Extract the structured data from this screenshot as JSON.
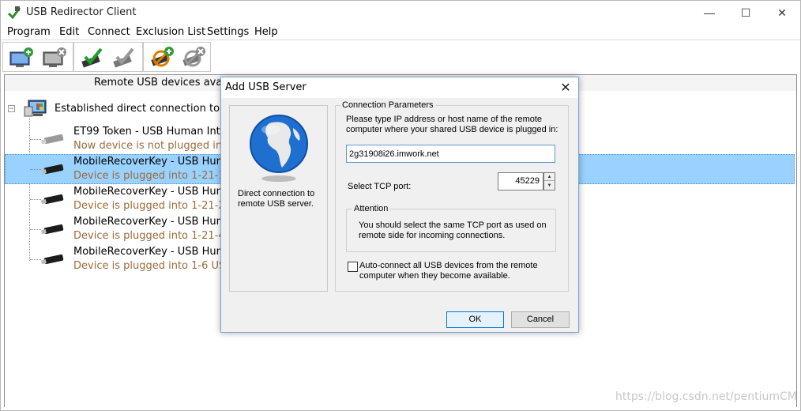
{
  "window": {
    "title": "USB Redirector Client",
    "minimize_glyph": "—",
    "maximize_glyph": "☐",
    "close_glyph": "✕"
  },
  "menu": [
    "Program",
    "Edit",
    "Connect",
    "Exclusion List",
    "Settings",
    "Help"
  ],
  "toolbar": {
    "buttons": [
      {
        "icon": "add-server-icon"
      },
      {
        "icon": "remove-server-icon"
      },
      {
        "icon": "connect-device-icon"
      },
      {
        "icon": "disconnect-device-icon"
      },
      {
        "icon": "add-exclusion-icon"
      },
      {
        "icon": "remove-exclusion-icon"
      }
    ]
  },
  "tab": {
    "label": "Remote USB devices avail"
  },
  "tree": {
    "expander": "−",
    "root_label": "Established direct connection to USB",
    "devices": [
      {
        "name": "ET99 Token - USB Human Interfa",
        "status": "Now device is not plugged into",
        "selected": false
      },
      {
        "name": "MobileRecoverKey - USB Human",
        "status": "Device is plugged into 1-21-1 US",
        "selected": true
      },
      {
        "name": "MobileRecoverKey - USB Human",
        "status": "Device is plugged into 1-21-2 US",
        "selected": false
      },
      {
        "name": "MobileRecoverKey - USB Human",
        "status": "Device is plugged into 1-21-4 US",
        "selected": false
      },
      {
        "name": "MobileRecoverKey - USB Human",
        "status": "Device is plugged into 1-6 USB p",
        "selected": false
      }
    ]
  },
  "watermark": "https://blog.csdn.net/pentiumCM",
  "dialog": {
    "title": "Add USB Server",
    "close_glyph": "✕",
    "left_caption": "Direct connection to remote USB server.",
    "group_label": "Connection Parameters",
    "instructions": "Please type IP address or host name of the remote computer where your shared USB device is plugged in:",
    "host_value": "2g31908i26.imwork.net",
    "port_label": "Select TCP port:",
    "port_value": "45229",
    "spin_up": "▲",
    "spin_down": "▼",
    "attention_label": "Attention",
    "attention_text": "You should select the same TCP port as used on remote side for incoming connections.",
    "autoconnect_label": "Auto-connect all USB devices from the remote computer when they become available.",
    "autoconnect_checked": false,
    "ok_label": "OK",
    "cancel_label": "Cancel"
  },
  "colors": {
    "selection": "#99d1ff",
    "status_text": "#9b6b3a",
    "dialog_border": "#7aa7d6",
    "ok_border": "#0078d7"
  }
}
